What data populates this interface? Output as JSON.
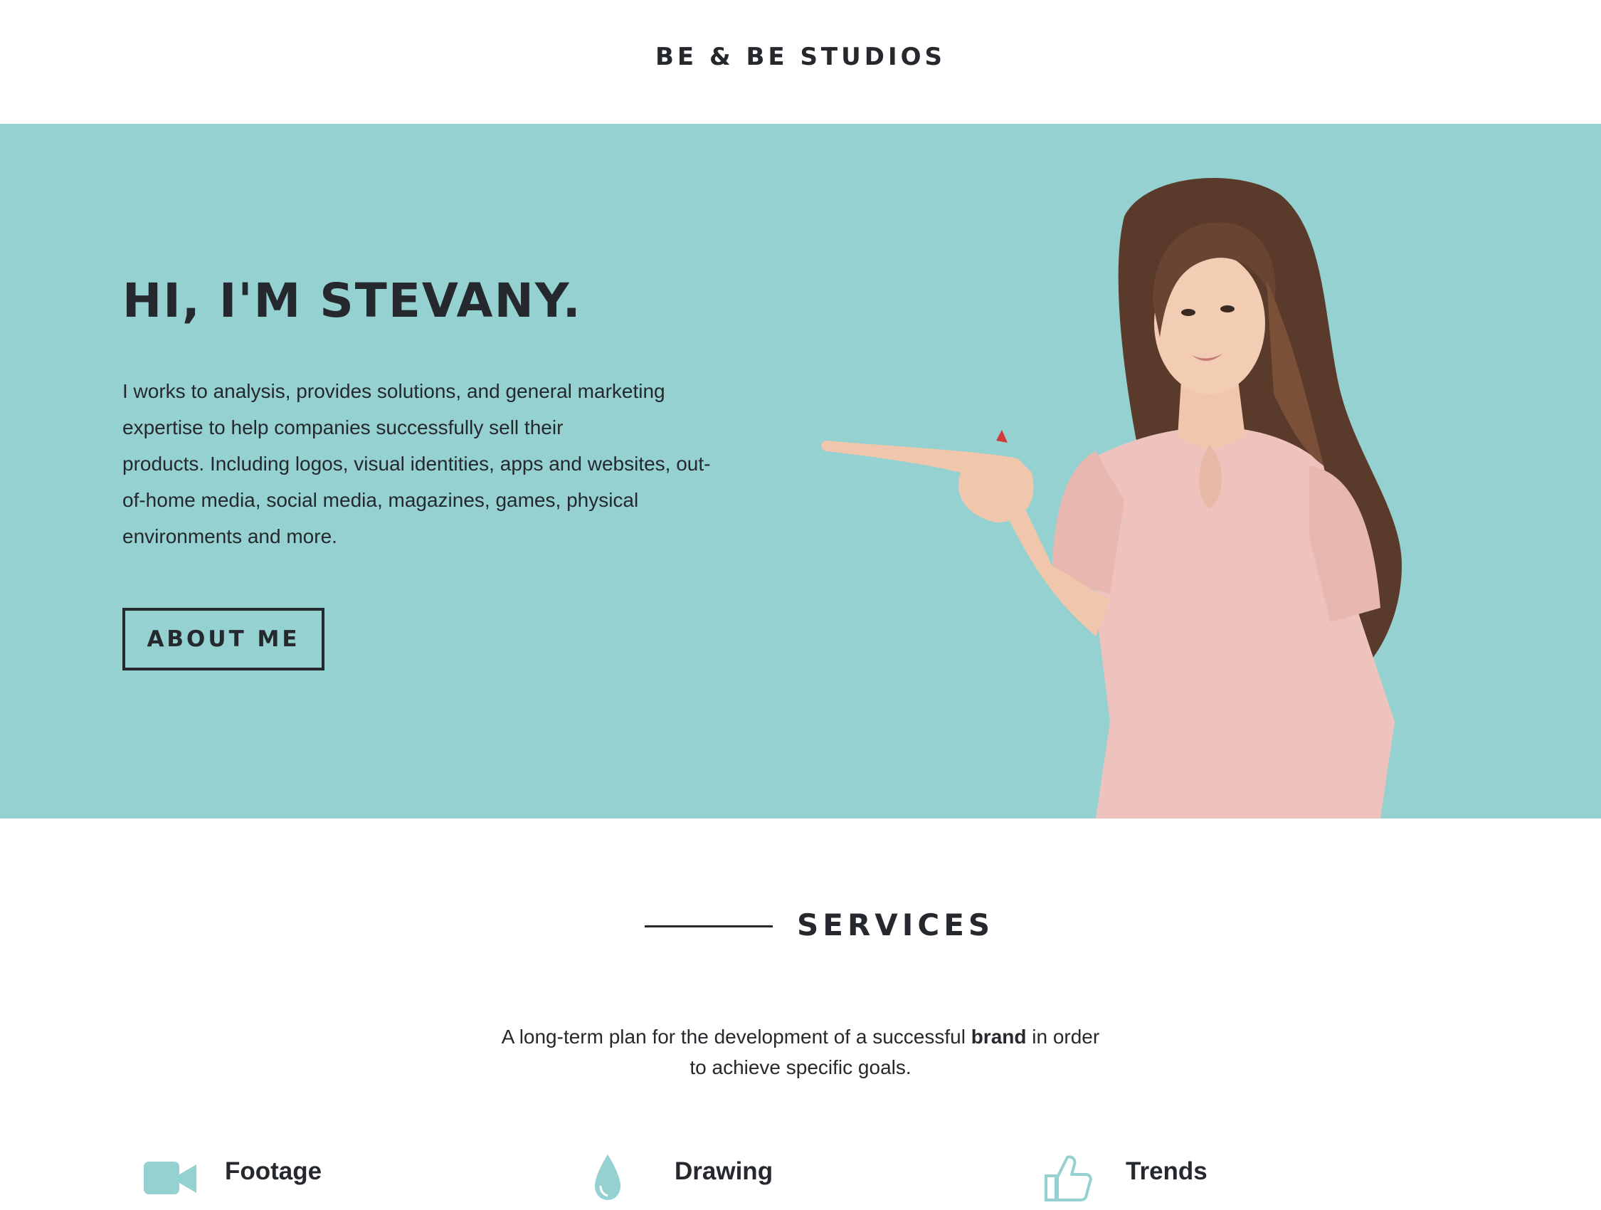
{
  "header": {
    "brand": "BE & BE STUDIOS"
  },
  "hero": {
    "title": "HI, I'M STEVANY.",
    "description_lines": [
      "I works to analysis, provides solutions, and general marketing",
      "expertise to help companies successfully sell their",
      "products. Including logos, visual identities, apps and websites, out-",
      "of-home media, social media, magazines, games, physical",
      "environments and more."
    ],
    "button_label": "ABOUT ME",
    "background_color": "#96d1d1"
  },
  "services": {
    "title": "SERVICES",
    "intro_line1_before": "A long-term plan for the development of a successful ",
    "intro_line1_bold": "brand",
    "intro_line1_after": " in order",
    "intro_line2": "to achieve specific goals.",
    "items": [
      {
        "label": "Footage",
        "icon": "video-camera-icon"
      },
      {
        "label": "Drawing",
        "icon": "water-drop-icon"
      },
      {
        "label": "Trends",
        "icon": "thumbs-up-icon"
      }
    ],
    "icon_color": "#96d1d1"
  }
}
